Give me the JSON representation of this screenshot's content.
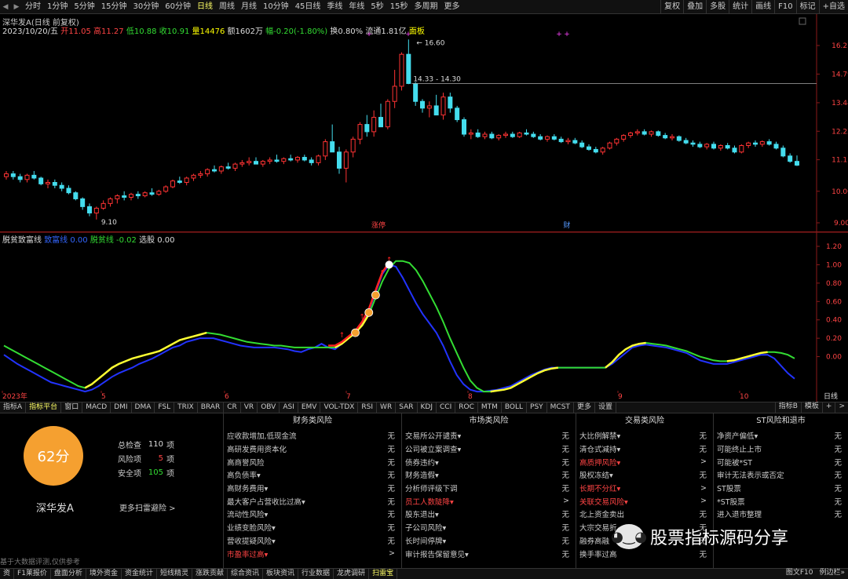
{
  "topbar": {
    "periods": [
      "分时",
      "1分钟",
      "5分钟",
      "15分钟",
      "30分钟",
      "60分钟",
      "日线",
      "周线",
      "月线",
      "10分钟",
      "45日线",
      "季线",
      "年线",
      "5秒",
      "15秒",
      "多周期",
      "更多"
    ],
    "active_period": "日线",
    "right_buttons": [
      "复权",
      "叠加",
      "多股",
      "统计",
      "画线",
      "F10",
      "标记",
      "+自选"
    ]
  },
  "info": {
    "title": "深华发A",
    "title_suffix": "(日线 前复权)",
    "date": "2023/10/20/五",
    "open": "开11.05",
    "high": "高11.27",
    "low": "低10.88",
    "close": "收10.91",
    "volume": "量14476",
    "amount": "额1602万",
    "change": "幅-0.20(-1.80%)",
    "turnover": "换0.80%",
    "float_cap": "流通1.81亿",
    "panel": "面板"
  },
  "main_chart": {
    "price_axis": [
      "16.27",
      "14.79",
      "13.44",
      "12.22",
      "11.11",
      "10.00",
      "9.00"
    ],
    "annotations": {
      "high_label": "16.60",
      "low_label": "9.10",
      "range_label": "14.33 - 14.30",
      "event_left": "涨停",
      "event_right": "财"
    },
    "candles": [
      [
        10.5,
        10.7,
        10.4,
        10.6
      ],
      [
        10.6,
        10.7,
        10.4,
        10.5
      ],
      [
        10.5,
        10.6,
        10.3,
        10.4
      ],
      [
        10.4,
        10.6,
        10.3,
        10.55
      ],
      [
        10.55,
        10.7,
        10.4,
        10.45
      ],
      [
        10.45,
        10.5,
        10.2,
        10.25
      ],
      [
        10.25,
        10.4,
        10.1,
        10.3
      ],
      [
        10.3,
        10.4,
        10.1,
        10.2
      ],
      [
        10.2,
        10.3,
        10.0,
        10.1
      ],
      [
        10.1,
        10.2,
        9.9,
        9.95
      ],
      [
        9.95,
        10.0,
        9.7,
        9.75
      ],
      [
        9.75,
        9.8,
        9.4,
        9.5
      ],
      [
        9.5,
        9.6,
        9.2,
        9.3
      ],
      [
        9.3,
        9.5,
        9.1,
        9.45
      ],
      [
        9.45,
        9.7,
        9.4,
        9.6
      ],
      [
        9.6,
        9.8,
        9.5,
        9.75
      ],
      [
        9.75,
        9.9,
        9.6,
        9.85
      ],
      [
        9.85,
        10.0,
        9.7,
        9.8
      ],
      [
        9.8,
        9.95,
        9.7,
        9.9
      ],
      [
        9.9,
        10.0,
        9.75,
        9.85
      ],
      [
        9.85,
        10.0,
        9.8,
        9.95
      ],
      [
        9.95,
        10.1,
        9.85,
        9.9
      ],
      [
        9.9,
        10.05,
        9.85,
        10.0
      ],
      [
        10.0,
        10.2,
        9.95,
        10.15
      ],
      [
        10.15,
        10.4,
        10.1,
        10.35
      ],
      [
        10.35,
        10.5,
        10.25,
        10.3
      ],
      [
        10.3,
        10.5,
        10.2,
        10.45
      ],
      [
        10.45,
        10.6,
        10.35,
        10.55
      ],
      [
        10.55,
        10.7,
        10.45,
        10.6
      ],
      [
        10.6,
        10.8,
        10.5,
        10.75
      ],
      [
        10.75,
        10.9,
        10.65,
        10.7
      ],
      [
        10.7,
        10.9,
        10.6,
        10.85
      ],
      [
        10.85,
        11.0,
        10.75,
        10.8
      ],
      [
        10.8,
        11.0,
        10.7,
        10.95
      ],
      [
        10.95,
        11.1,
        10.85,
        11.0
      ],
      [
        11.0,
        11.2,
        10.9,
        11.05
      ],
      [
        11.05,
        11.2,
        10.95,
        10.95
      ],
      [
        10.95,
        11.1,
        10.85,
        11.05
      ],
      [
        11.05,
        11.2,
        10.95,
        11.1
      ],
      [
        11.1,
        11.3,
        11.0,
        11.05
      ],
      [
        11.05,
        11.2,
        10.95,
        11.15
      ],
      [
        11.15,
        11.3,
        11.05,
        11.1
      ],
      [
        11.1,
        11.25,
        11.0,
        11.2
      ],
      [
        11.2,
        11.3,
        11.05,
        11.1
      ],
      [
        11.1,
        11.2,
        10.9,
        11.0
      ],
      [
        11.0,
        11.3,
        10.9,
        11.25
      ],
      [
        11.25,
        11.9,
        11.1,
        11.8
      ],
      [
        11.8,
        12.5,
        11.6,
        11.4
      ],
      [
        11.4,
        11.6,
        10.6,
        10.8
      ],
      [
        10.8,
        11.5,
        10.3,
        11.4
      ],
      [
        11.4,
        12.0,
        11.2,
        11.9
      ],
      [
        11.9,
        12.6,
        11.7,
        12.5
      ],
      [
        12.5,
        12.9,
        12.0,
        12.2
      ],
      [
        12.2,
        13.1,
        12.0,
        12.8
      ],
      [
        12.8,
        13.4,
        12.6,
        12.4
      ],
      [
        12.4,
        13.6,
        12.3,
        13.5
      ],
      [
        13.5,
        15.0,
        13.2,
        14.2
      ],
      [
        14.2,
        15.9,
        14.0,
        15.8
      ],
      [
        15.8,
        16.6,
        14.3,
        14.33
      ],
      [
        14.33,
        14.4,
        13.3,
        13.5
      ],
      [
        13.5,
        13.6,
        13.0,
        13.2
      ],
      [
        13.2,
        13.5,
        12.8,
        13.3
      ],
      [
        13.3,
        13.8,
        13.0,
        12.9
      ],
      [
        12.9,
        13.9,
        12.7,
        13.7
      ],
      [
        13.7,
        13.9,
        13.0,
        13.2
      ],
      [
        13.2,
        13.3,
        12.6,
        12.7
      ],
      [
        12.7,
        12.8,
        12.0,
        12.1
      ],
      [
        12.1,
        12.3,
        11.9,
        12.15
      ],
      [
        12.15,
        12.3,
        11.95,
        12.0
      ],
      [
        12.0,
        12.2,
        11.9,
        12.1
      ],
      [
        12.1,
        12.2,
        11.9,
        11.95
      ],
      [
        11.95,
        12.1,
        11.85,
        12.05
      ],
      [
        12.05,
        12.2,
        11.95,
        12.1
      ],
      [
        12.1,
        12.2,
        11.95,
        12.0
      ],
      [
        12.0,
        12.2,
        11.95,
        12.15
      ],
      [
        12.15,
        12.3,
        12.05,
        12.1
      ],
      [
        12.1,
        12.2,
        11.95,
        12.0
      ],
      [
        12.0,
        12.1,
        11.85,
        11.9
      ],
      [
        11.9,
        12.05,
        11.8,
        12.0
      ],
      [
        12.0,
        12.1,
        11.85,
        11.9
      ],
      [
        11.9,
        12.0,
        11.75,
        11.8
      ],
      [
        11.8,
        11.95,
        11.7,
        11.85
      ],
      [
        11.85,
        11.95,
        11.7,
        11.75
      ],
      [
        11.75,
        11.85,
        11.55,
        11.6
      ],
      [
        11.6,
        11.7,
        11.45,
        11.5
      ],
      [
        11.5,
        11.6,
        11.35,
        11.4
      ],
      [
        11.4,
        11.6,
        11.3,
        11.55
      ],
      [
        11.55,
        11.8,
        11.5,
        11.75
      ],
      [
        11.75,
        11.95,
        11.65,
        11.9
      ],
      [
        11.9,
        12.1,
        11.8,
        12.05
      ],
      [
        12.05,
        12.2,
        11.95,
        12.15
      ],
      [
        12.15,
        12.3,
        12.05,
        12.2
      ],
      [
        12.2,
        12.3,
        12.05,
        12.1
      ],
      [
        12.1,
        12.25,
        12.0,
        12.2
      ],
      [
        12.2,
        12.25,
        12.0,
        12.05
      ],
      [
        12.05,
        12.15,
        11.9,
        11.95
      ],
      [
        11.95,
        12.1,
        11.85,
        12.0
      ],
      [
        12.0,
        12.05,
        11.8,
        11.85
      ],
      [
        11.85,
        11.95,
        11.7,
        11.75
      ],
      [
        11.75,
        11.85,
        11.6,
        11.7
      ],
      [
        11.7,
        11.8,
        11.55,
        11.6
      ],
      [
        11.6,
        11.75,
        11.5,
        11.7
      ],
      [
        11.7,
        11.8,
        11.5,
        11.55
      ],
      [
        11.55,
        11.7,
        11.45,
        11.65
      ],
      [
        11.65,
        11.75,
        11.5,
        11.55
      ],
      [
        11.55,
        11.65,
        11.35,
        11.4
      ],
      [
        11.4,
        11.7,
        11.35,
        11.65
      ],
      [
        11.65,
        11.8,
        11.55,
        11.75
      ],
      [
        11.75,
        11.85,
        11.6,
        11.7
      ],
      [
        11.7,
        11.85,
        11.6,
        11.8
      ],
      [
        11.8,
        11.9,
        11.65,
        11.7
      ],
      [
        11.7,
        11.8,
        11.5,
        11.55
      ],
      [
        11.55,
        11.65,
        11.2,
        11.25
      ],
      [
        11.25,
        11.35,
        11.0,
        11.05
      ],
      [
        11.05,
        11.27,
        10.88,
        10.91
      ]
    ]
  },
  "indicator": {
    "name": "脱贫致富线",
    "line1_label": "致富线",
    "line1_value": "0.00",
    "line2_label": "脱贫线",
    "line2_value": "-0.02",
    "choice_label": "选股",
    "choice_value": "0.00",
    "axis": [
      "1.20",
      "1.00",
      "0.80",
      "0.60",
      "0.40",
      "0.20",
      "0.00",
      "-0.20"
    ],
    "months": [
      "2023年",
      "5",
      "6",
      "7",
      "8",
      "9",
      "10"
    ],
    "period_label": "日线",
    "blue_line": [
      0.02,
      -0.03,
      -0.08,
      -0.12,
      -0.16,
      -0.2,
      -0.24,
      -0.28,
      -0.3,
      -0.32,
      -0.34,
      -0.36,
      -0.38,
      -0.36,
      -0.32,
      -0.27,
      -0.22,
      -0.18,
      -0.15,
      -0.12,
      -0.08,
      -0.05,
      -0.02,
      0.02,
      0.06,
      0.1,
      0.12,
      0.16,
      0.18,
      0.2,
      0.2,
      0.2,
      0.18,
      0.16,
      0.14,
      0.12,
      0.11,
      0.1,
      0.1,
      0.1,
      0.1,
      0.09,
      0.08,
      0.06,
      0.05,
      0.08,
      0.1,
      0.14,
      0.1,
      0.08,
      0.14,
      0.2,
      0.26,
      0.36,
      0.5,
      0.7,
      0.9,
      1.0,
      0.98,
      0.86,
      0.72,
      0.58,
      0.46,
      0.36,
      0.26,
      0.12,
      -0.05,
      -0.2,
      -0.3,
      -0.36,
      -0.38,
      -0.38,
      -0.37,
      -0.36,
      -0.34,
      -0.32,
      -0.28,
      -0.24,
      -0.2,
      -0.17,
      -0.14,
      -0.12,
      -0.12,
      -0.12,
      -0.12,
      -0.12,
      -0.12,
      -0.12,
      -0.12,
      -0.12,
      -0.08,
      -0.02,
      0.04,
      0.1,
      0.12,
      0.13,
      0.12,
      0.11,
      0.1,
      0.08,
      0.06,
      0.04,
      0.0,
      -0.04,
      -0.06,
      -0.08,
      -0.08,
      -0.08,
      -0.06,
      -0.04,
      -0.02,
      0.0,
      0.02,
      0.02,
      -0.02,
      -0.1,
      -0.18,
      -0.24
    ],
    "green_line": [
      0.12,
      0.08,
      0.04,
      0.0,
      -0.04,
      -0.08,
      -0.12,
      -0.16,
      -0.2,
      -0.24,
      -0.28,
      -0.32,
      -0.34,
      -0.3,
      -0.24,
      -0.18,
      -0.12,
      -0.08,
      -0.05,
      -0.02,
      0.0,
      0.02,
      0.04,
      0.06,
      0.1,
      0.14,
      0.18,
      0.2,
      0.22,
      0.24,
      0.26,
      0.25,
      0.24,
      0.22,
      0.2,
      0.18,
      0.16,
      0.15,
      0.14,
      0.13,
      0.12,
      0.12,
      0.11,
      0.1,
      0.1,
      0.1,
      0.1,
      0.1,
      0.1,
      0.1,
      0.14,
      0.2,
      0.26,
      0.34,
      0.46,
      0.64,
      0.82,
      0.96,
      1.04,
      1.04,
      1.02,
      0.94,
      0.82,
      0.68,
      0.54,
      0.38,
      0.2,
      0.04,
      -0.12,
      -0.26,
      -0.34,
      -0.38,
      -0.38,
      -0.37,
      -0.36,
      -0.34,
      -0.3,
      -0.26,
      -0.22,
      -0.18,
      -0.15,
      -0.13,
      -0.12,
      -0.12,
      -0.12,
      -0.12,
      -0.12,
      -0.12,
      -0.12,
      -0.12,
      -0.06,
      0.02,
      0.08,
      0.12,
      0.14,
      0.15,
      0.14,
      0.13,
      0.12,
      0.1,
      0.08,
      0.06,
      0.03,
      0.0,
      -0.02,
      -0.04,
      -0.05,
      -0.05,
      -0.04,
      -0.02,
      0.0,
      0.02,
      0.04,
      0.05,
      0.05,
      0.04,
      0.02,
      -0.02
    ]
  },
  "tabs": {
    "items": [
      "指标A",
      "指标平台",
      "窗口",
      "MACD",
      "DMI",
      "DMA",
      "FSL",
      "TRIX",
      "BRAR",
      "CR",
      "VR",
      "OBV",
      "ASI",
      "EMV",
      "VOL-TDX",
      "RSI",
      "WR",
      "SAR",
      "KDJ",
      "CCI",
      "ROC",
      "MTM",
      "BOLL",
      "PSY",
      "MCST",
      "更多",
      "设置"
    ],
    "active": "指标平台",
    "right": [
      "指标B",
      "模板",
      "+",
      ">"
    ]
  },
  "risk": {
    "score": "62分",
    "stock_name": "深华发A",
    "total_label": "总检查",
    "total_value": "110",
    "risk_label": "风险项",
    "risk_value": "5",
    "safe_label": "安全项",
    "safe_value": "105",
    "unit": "项",
    "more_link": "更多扫雷避险 >",
    "disclaimer": "基于大数据评测,仅供参考",
    "colors": {
      "score_bg": "#f5a030",
      "risk": "#ff4444",
      "safe": "#33dd33"
    },
    "columns": [
      {
        "title": "财务类风险",
        "rows": [
          {
            "name": "应收款增加,低现金流",
            "hot": false,
            "status": "无"
          },
          {
            "name": "高研发费用资本化",
            "hot": false,
            "status": "无"
          },
          {
            "name": "高商誉风险",
            "hot": false,
            "status": "无"
          },
          {
            "name": "高负债率▾",
            "hot": false,
            "status": "无"
          },
          {
            "name": "高财务费用▾",
            "hot": false,
            "status": "无"
          },
          {
            "name": "最大客户占营收比过高▾",
            "hot": false,
            "status": "无"
          },
          {
            "name": "流动性风险▾",
            "hot": false,
            "status": "无"
          },
          {
            "name": "业绩变脸风险▾",
            "hot": false,
            "status": "无"
          },
          {
            "name": "营收提疑风险▾",
            "hot": false,
            "status": "无"
          },
          {
            "name": "市盈率过高▾",
            "hot": true,
            "status": ">"
          }
        ]
      },
      {
        "title": "市场类风险",
        "rows": [
          {
            "name": "交易所公开谴责▾",
            "hot": false,
            "status": "无"
          },
          {
            "name": "公司被立案调查▾",
            "hot": false,
            "status": "无"
          },
          {
            "name": "债券违约▾",
            "hot": false,
            "status": "无"
          },
          {
            "name": "财务造假▾",
            "hot": false,
            "status": "无"
          },
          {
            "name": "分析师评级下调",
            "hot": false,
            "status": "无"
          },
          {
            "name": "员工人数陡降▾",
            "hot": true,
            "status": ">"
          },
          {
            "name": "股东退出▾",
            "hot": false,
            "status": "无"
          },
          {
            "name": "子公司风险▾",
            "hot": false,
            "status": "无"
          },
          {
            "name": "长时间停牌▾",
            "hot": false,
            "status": "无"
          },
          {
            "name": "审计报告保留意见▾",
            "hot": false,
            "status": "无"
          }
        ]
      },
      {
        "title": "交易类风险",
        "rows": [
          {
            "name": "大比例解禁▾",
            "hot": false,
            "status": "无"
          },
          {
            "name": "清仓式减持▾",
            "hot": false,
            "status": "无"
          },
          {
            "name": "高质押风险▾",
            "hot": true,
            "status": ">"
          },
          {
            "name": "股权冻结▾",
            "hot": false,
            "status": "无"
          },
          {
            "name": "长期不分红▾",
            "hot": true,
            "status": ">"
          },
          {
            "name": "关联交易风险▾",
            "hot": true,
            "status": ">"
          },
          {
            "name": "北上资金卖出",
            "hot": false,
            "status": "无"
          },
          {
            "name": "大宗交易折",
            "hot": false,
            "status": "无"
          },
          {
            "name": "融券高融",
            "hot": false,
            "status": "无"
          },
          {
            "name": "换手率过高",
            "hot": false,
            "status": "无"
          }
        ]
      },
      {
        "title": "ST风险和退市",
        "rows": [
          {
            "name": "净资产偏低▾",
            "hot": false,
            "status": "无"
          },
          {
            "name": "可能终止上市",
            "hot": false,
            "status": "无"
          },
          {
            "name": "可能被*ST",
            "hot": false,
            "status": "无"
          },
          {
            "name": "审计无法表示或否定",
            "hot": false,
            "status": "无"
          },
          {
            "name": "ST股票",
            "hot": false,
            "status": "无"
          },
          {
            "name": "*ST股票",
            "hot": false,
            "status": "无"
          },
          {
            "name": "进入退市整理",
            "hot": false,
            "status": "无"
          }
        ]
      }
    ]
  },
  "watermark": {
    "text": "股票指标源码分享"
  },
  "bottombar": {
    "items": [
      "资",
      "F1莱报价",
      "盘面分析",
      "境外资金",
      "资金统计",
      "短线精灵",
      "涨跌贡献",
      "综合资讯",
      "板块资讯",
      "行业数据",
      "龙虎调研",
      "扫雷宝"
    ],
    "active": "扫雷宝",
    "right": [
      "图文F10",
      "例边栏»"
    ]
  }
}
